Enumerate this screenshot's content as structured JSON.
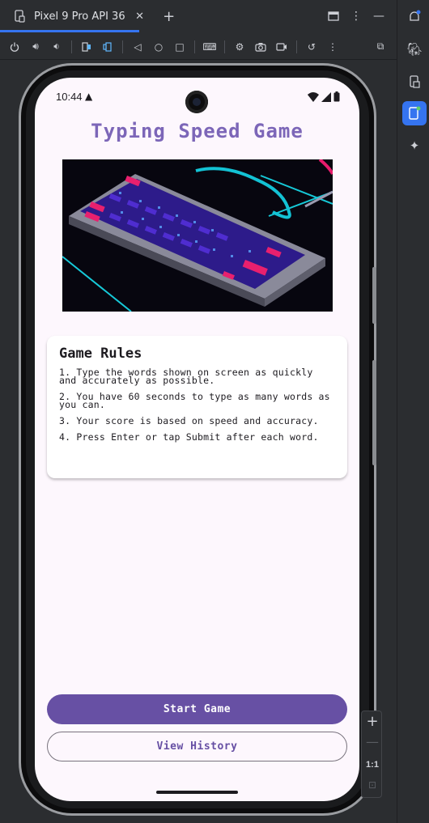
{
  "ide": {
    "device_tab": "Pixel 9 Pro API 36",
    "zoom_ratio": "1:1"
  },
  "phone": {
    "status_time": "10:44",
    "app": {
      "title": "Typing Speed Game",
      "rules_title": "Game Rules",
      "rules": [
        "1. Type the words shown on screen as quickly and accurately as possible.",
        "2. You have 60 seconds to type as many words as you can.",
        "3. Your score is based on speed and accuracy.",
        "4. Press Enter or tap Submit after each word."
      ],
      "start_button": "Start Game",
      "history_button": "View History"
    }
  },
  "colors": {
    "primary": "#6750a4",
    "title": "#7c66b8",
    "accent_blue": "#3574f0"
  }
}
